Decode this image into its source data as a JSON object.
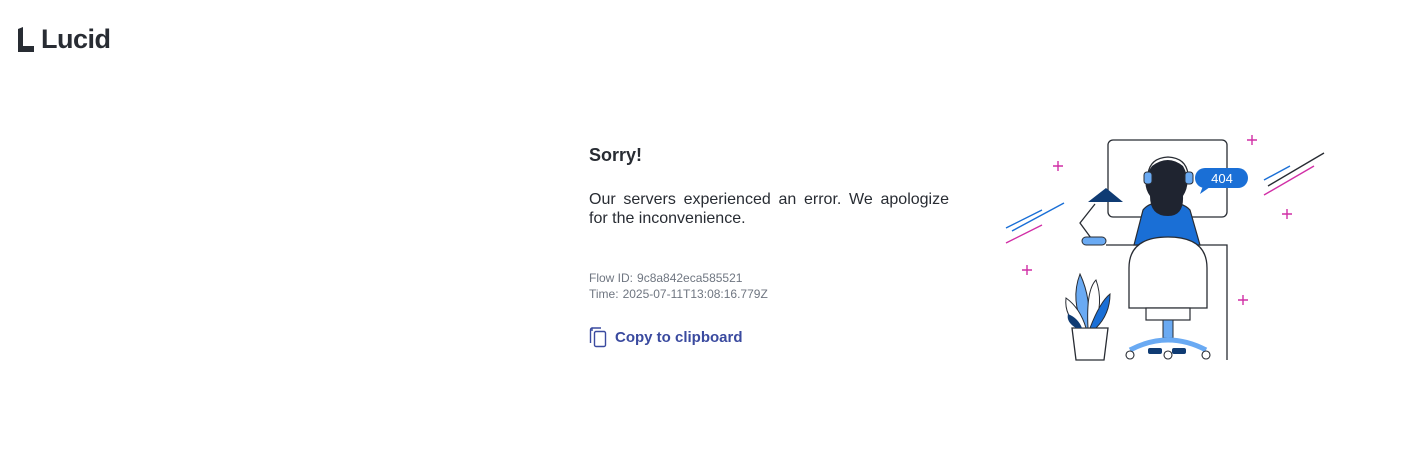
{
  "header": {
    "logo_text": "Lucid"
  },
  "error": {
    "title": "Sorry!",
    "message": "Our servers experienced an error. We apologize for the inconvenience.",
    "flow_id_label": "Flow ID:",
    "flow_id_value": "9c8a842eca585521",
    "time_label": "Time:",
    "time_value": "2025-07-11T13:08:16.779Z",
    "copy_label": "Copy to clipboard"
  },
  "illustration": {
    "badge_text": "404"
  },
  "colors": {
    "text_dark": "#282c33",
    "text_muted": "#6f7681",
    "link": "#3a4a9f",
    "accent_blue": "#1a6fd6",
    "accent_magenta": "#d12fa6",
    "navy": "#0f3b73"
  }
}
